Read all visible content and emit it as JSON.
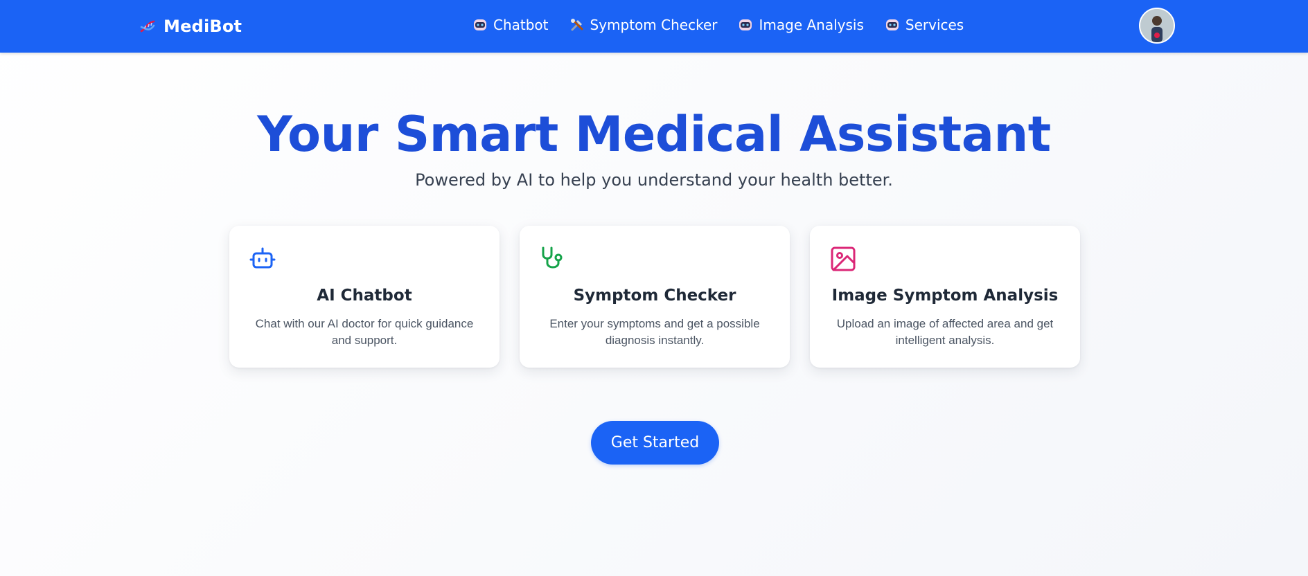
{
  "navbar": {
    "brand": {
      "icon": "dna-icon",
      "name": "MediBot"
    },
    "links": [
      {
        "label": "Chatbot",
        "icon": "robot-face-icon"
      },
      {
        "label": "Symptom Checker",
        "icon": "tools-icon"
      },
      {
        "label": "Image Analysis",
        "icon": "robot-face-icon"
      },
      {
        "label": "Services",
        "icon": "robot-face-icon"
      }
    ],
    "avatar": {
      "icon": "user-avatar-icon"
    }
  },
  "hero": {
    "title": "Your Smart Medical Assistant",
    "subtitle": "Powered by AI to help you understand your health better."
  },
  "cards": [
    {
      "icon": "bot-icon",
      "icon_color": "#1b63f5",
      "title": "AI Chatbot",
      "description": "Chat with our AI doctor for quick guidance and support."
    },
    {
      "icon": "stethoscope-icon",
      "icon_color": "#16a34a",
      "title": "Symptom Checker",
      "description": "Enter your symptoms and get a possible diagnosis instantly."
    },
    {
      "icon": "image-icon",
      "icon_color": "#db2777",
      "title": "Image Symptom Analysis",
      "description": "Upload an image of affected area and get intelligent analysis."
    }
  ],
  "cta": {
    "label": "Get Started"
  },
  "colors": {
    "primary": "#1b63f5",
    "title": "#1d4ed8",
    "background": "#f4f6fa"
  }
}
